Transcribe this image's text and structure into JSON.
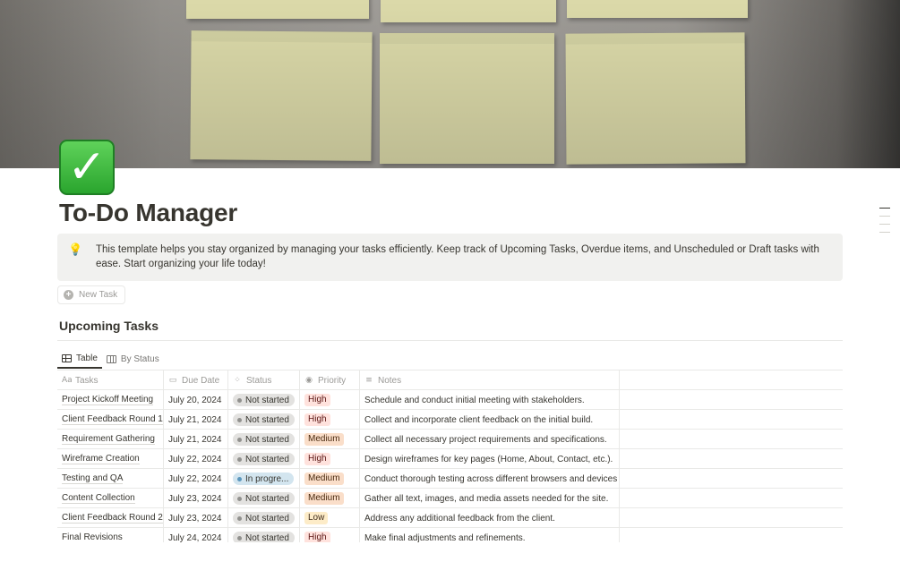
{
  "colors": {
    "accent": "#37352f",
    "callout_bg": "#f1f1ef",
    "status_not_started": "#e3e2e0",
    "status_in_progress": "#d3e5ef",
    "priority_high": "#ffe2dd",
    "priority_medium": "#fadec9",
    "priority_low": "#fdecc8"
  },
  "page": {
    "icon": "check-mark-button-icon",
    "title": "To-Do Manager"
  },
  "callout": {
    "icon": "light-bulb-icon",
    "text": "This template helps you stay organized by managing your tasks efficiently. Keep track of Upcoming Tasks, Overdue items, and Unscheduled or Draft tasks with ease. Start organizing your life today!"
  },
  "new_task_label": "New Task",
  "section": {
    "title": "Upcoming Tasks",
    "tabs": [
      {
        "label": "Table",
        "icon": "table-icon",
        "active": true
      },
      {
        "label": "By Status",
        "icon": "board-icon",
        "active": false
      }
    ]
  },
  "table": {
    "headers": [
      {
        "label": "Tasks",
        "icon": "Aa"
      },
      {
        "label": "Due Date",
        "icon": "calendar-icon"
      },
      {
        "label": "Status",
        "icon": "status-spinner-icon"
      },
      {
        "label": "Priority",
        "icon": "select-icon"
      },
      {
        "label": "Notes",
        "icon": "text-lines-icon"
      }
    ],
    "rows": [
      {
        "task": "Project Kickoff Meeting",
        "due": "July 20, 2024",
        "status": "Not started",
        "priority": "High",
        "notes": "Schedule and conduct initial meeting with stakeholders."
      },
      {
        "task": "Client Feedback Round 1",
        "due": "July 21, 2024",
        "status": "Not started",
        "priority": "High",
        "notes": "Collect and incorporate client feedback on the initial build."
      },
      {
        "task": "Requirement Gathering",
        "due": "July 21, 2024",
        "status": "Not started",
        "priority": "Medium",
        "notes": "Collect all necessary project requirements and specifications."
      },
      {
        "task": "Wireframe Creation",
        "due": "July 22, 2024",
        "status": "Not started",
        "priority": "High",
        "notes": "Design wireframes for key pages (Home, About, Contact, etc.)."
      },
      {
        "task": "Testing and QA",
        "due": "July 22, 2024",
        "status": "In progre...",
        "priority": "Medium",
        "notes": "Conduct thorough testing across different browsers and devices"
      },
      {
        "task": "Content Collection",
        "due": "July 23, 2024",
        "status": "Not started",
        "priority": "Medium",
        "notes": "Gather all text, images, and media assets needed for the site."
      },
      {
        "task": "Client Feedback Round 2",
        "due": "July 23, 2024",
        "status": "Not started",
        "priority": "Low",
        "notes": "Address any additional feedback from the client."
      },
      {
        "task": "Final Revisions",
        "due": "July 24, 2024",
        "status": "Not started",
        "priority": "High",
        "notes": "Make final adjustments and refinements."
      }
    ]
  }
}
